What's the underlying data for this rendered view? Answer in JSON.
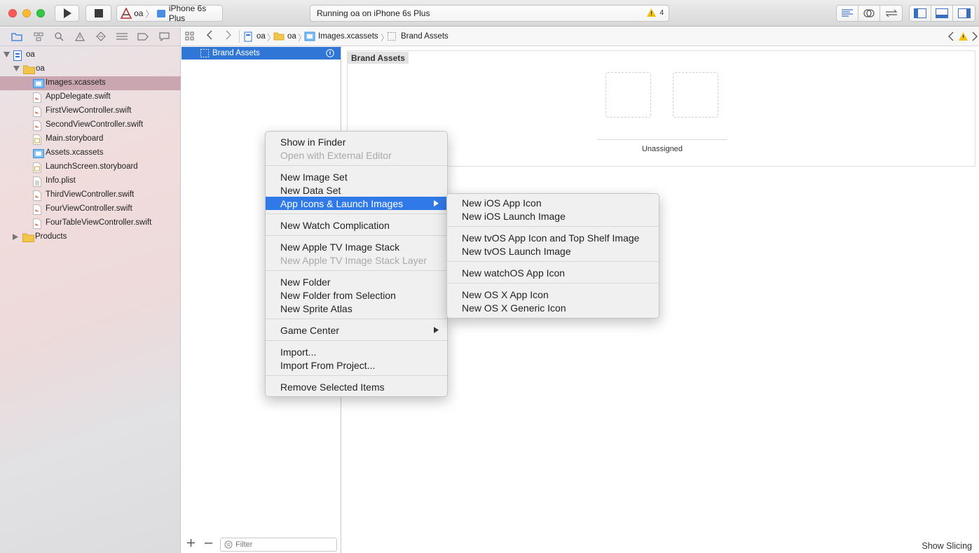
{
  "toolbar": {
    "scheme_target": "oa",
    "scheme_device": "iPhone 6s Plus",
    "status_text": "Running oa on iPhone 6s Plus",
    "warning_count": "4"
  },
  "navigator": {
    "tree": [
      {
        "label": "oa",
        "kind": "project",
        "level": 0,
        "expanded": true
      },
      {
        "label": "oa",
        "kind": "folder",
        "level": 1,
        "expanded": true
      },
      {
        "label": "Images.xcassets",
        "kind": "assets",
        "level": 2,
        "selected": true
      },
      {
        "label": "AppDelegate.swift",
        "kind": "swift",
        "level": 2
      },
      {
        "label": "FirstViewController.swift",
        "kind": "swift",
        "level": 2
      },
      {
        "label": "SecondViewController.swift",
        "kind": "swift",
        "level": 2
      },
      {
        "label": "Main.storyboard",
        "kind": "storyboard",
        "level": 2
      },
      {
        "label": "Assets.xcassets",
        "kind": "assets",
        "level": 2
      },
      {
        "label": "LaunchScreen.storyboard",
        "kind": "storyboard",
        "level": 2
      },
      {
        "label": "Info.plist",
        "kind": "plist",
        "level": 2
      },
      {
        "label": "ThirdViewController.swift",
        "kind": "swift",
        "level": 2
      },
      {
        "label": "FourViewController.swift",
        "kind": "swift",
        "level": 2
      },
      {
        "label": "FourTableViewController.swift",
        "kind": "swift",
        "level": 2
      },
      {
        "label": "Products",
        "kind": "folder",
        "level": 0,
        "expanded": false
      }
    ]
  },
  "jumpbar": {
    "crumbs": [
      "oa",
      "oa",
      "Images.xcassets",
      "Brand Assets"
    ]
  },
  "asset_list": {
    "selected_item": "Brand Assets",
    "filter_placeholder": "Filter"
  },
  "editor": {
    "group_title": "Brand Assets",
    "slot_label": "Unassigned",
    "show_slicing": "Show Slicing"
  },
  "context_menu": {
    "items": [
      {
        "label": "Show in Finder",
        "enabled": true
      },
      {
        "label": "Open with External Editor",
        "enabled": false
      },
      {
        "separator": true
      },
      {
        "label": "New Image Set",
        "enabled": true
      },
      {
        "label": "New Data Set",
        "enabled": true
      },
      {
        "label": "App Icons & Launch Images",
        "enabled": true,
        "submenu": true,
        "highlighted": true
      },
      {
        "separator": true
      },
      {
        "label": "New Watch Complication",
        "enabled": true
      },
      {
        "separator": true
      },
      {
        "label": "New Apple TV Image Stack",
        "enabled": true
      },
      {
        "label": "New Apple TV Image Stack Layer",
        "enabled": false
      },
      {
        "separator": true
      },
      {
        "label": "New Folder",
        "enabled": true
      },
      {
        "label": "New Folder from Selection",
        "enabled": true
      },
      {
        "label": "New Sprite Atlas",
        "enabled": true
      },
      {
        "separator": true
      },
      {
        "label": "Game Center",
        "enabled": true,
        "submenu": true
      },
      {
        "separator": true
      },
      {
        "label": "Import...",
        "enabled": true
      },
      {
        "label": "Import From Project...",
        "enabled": true
      },
      {
        "separator": true
      },
      {
        "label": "Remove Selected Items",
        "enabled": true
      }
    ]
  },
  "submenu": {
    "items": [
      {
        "label": "New iOS App Icon"
      },
      {
        "label": "New iOS Launch Image"
      },
      {
        "separator": true
      },
      {
        "label": "New tvOS App Icon and Top Shelf Image"
      },
      {
        "label": "New tvOS Launch Image"
      },
      {
        "separator": true
      },
      {
        "label": "New watchOS App Icon"
      },
      {
        "separator": true
      },
      {
        "label": "New OS X App Icon"
      },
      {
        "label": "New OS X Generic Icon"
      }
    ]
  }
}
